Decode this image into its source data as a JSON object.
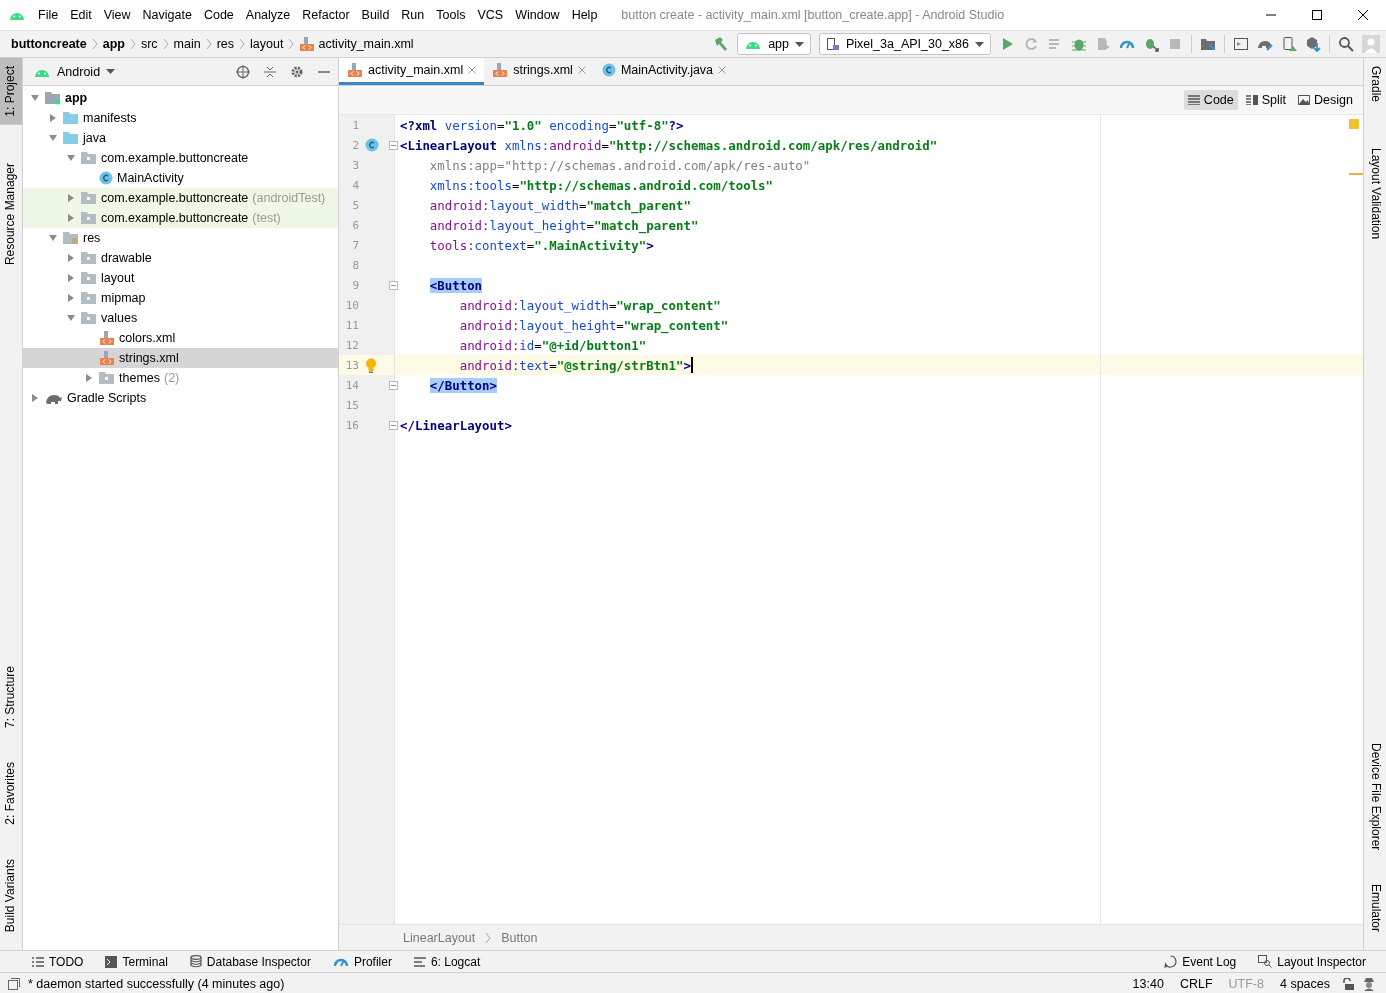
{
  "window": {
    "title": "button create - activity_main.xml [button_create.app] - Android Studio"
  },
  "menu": [
    "File",
    "Edit",
    "View",
    "Navigate",
    "Code",
    "Analyze",
    "Refactor",
    "Build",
    "Run",
    "Tools",
    "VCS",
    "Window",
    "Help"
  ],
  "breadcrumbs": [
    {
      "label": "buttoncreate",
      "bold": true
    },
    {
      "label": "app",
      "bold": true
    },
    {
      "label": "src",
      "bold": false
    },
    {
      "label": "main",
      "bold": false
    },
    {
      "label": "res",
      "bold": false
    },
    {
      "label": "layout",
      "bold": false
    },
    {
      "label": "activity_main.xml",
      "bold": false,
      "kind": "xml"
    }
  ],
  "toolbar": {
    "run_config": "app",
    "device": "Pixel_3a_API_30_x86",
    "icons": [
      {
        "kind": "run",
        "disabled": false
      },
      {
        "kind": "rerun",
        "disabled": true
      },
      {
        "kind": "apply",
        "disabled": true
      },
      {
        "kind": "debug",
        "disabled": false
      },
      {
        "kind": "profile",
        "disabled": true
      },
      {
        "kind": "gauge",
        "disabled": false
      },
      {
        "kind": "attach",
        "disabled": false
      },
      {
        "kind": "stop",
        "disabled": true
      },
      {
        "kind": "sep"
      },
      {
        "kind": "structure",
        "disabled": false
      },
      {
        "kind": "sep"
      },
      {
        "kind": "avd",
        "disabled": false
      },
      {
        "kind": "sync",
        "disabled": false
      },
      {
        "kind": "device",
        "disabled": false
      },
      {
        "kind": "sdk",
        "disabled": false
      },
      {
        "kind": "sep"
      },
      {
        "kind": "search",
        "disabled": false
      },
      {
        "kind": "avatar",
        "disabled": false
      }
    ]
  },
  "left_strip": {
    "top": [
      {
        "label": "1: Project",
        "selected": true
      },
      {
        "label": "Resource Manager",
        "selected": false
      }
    ],
    "bottom": [
      {
        "label": "7: Structure",
        "selected": false
      },
      {
        "label": "2: Favorites",
        "selected": false
      },
      {
        "label": "Build Variants",
        "selected": false
      }
    ]
  },
  "right_strip": {
    "top": [
      {
        "label": "Gradle",
        "selected": false
      },
      {
        "label": "Layout Validation",
        "selected": false
      }
    ],
    "bottom": [
      {
        "label": "Device File Explorer",
        "selected": false
      },
      {
        "label": "Emulator",
        "selected": false
      }
    ]
  },
  "project_panel": {
    "view": "Android",
    "tree": [
      {
        "label": "app",
        "kind": "module",
        "expanded": true,
        "selected": false,
        "children": [
          {
            "label": "manifests",
            "kind": "folder",
            "expanded": false,
            "selected": false
          },
          {
            "label": "java",
            "kind": "folder",
            "expanded": true,
            "selected": false,
            "children": [
              {
                "label": "com.example.buttoncreate",
                "kind": "package",
                "expanded": true,
                "selected": false,
                "children": [
                  {
                    "label": "MainActivity",
                    "kind": "class",
                    "selected": false
                  }
                ]
              },
              {
                "label": "com.example.buttoncreate",
                "suffix": "(androidTest)",
                "kind": "package",
                "expanded": false,
                "selected": false,
                "test": true
              },
              {
                "label": "com.example.buttoncreate",
                "suffix": "(test)",
                "kind": "package",
                "expanded": false,
                "selected": false,
                "test": true
              }
            ]
          },
          {
            "label": "res",
            "kind": "res",
            "expanded": true,
            "selected": false,
            "children": [
              {
                "label": "drawable",
                "kind": "package",
                "expanded": false,
                "selected": false
              },
              {
                "label": "layout",
                "kind": "package",
                "expanded": false,
                "selected": false
              },
              {
                "label": "mipmap",
                "kind": "package",
                "expanded": false,
                "selected": false
              },
              {
                "label": "values",
                "kind": "package",
                "expanded": true,
                "selected": false,
                "children": [
                  {
                    "label": "colors.xml",
                    "kind": "xml",
                    "selected": false
                  },
                  {
                    "label": "strings.xml",
                    "kind": "xml",
                    "selected": true
                  },
                  {
                    "label": "themes",
                    "suffix": "(2)",
                    "kind": "package",
                    "expanded": false,
                    "selected": false
                  }
                ]
              }
            ]
          }
        ]
      },
      {
        "label": "Gradle Scripts",
        "kind": "gradle",
        "expanded": false,
        "selected": false
      }
    ]
  },
  "editor": {
    "tabs": [
      {
        "label": "activity_main.xml",
        "kind": "xml",
        "selected": true
      },
      {
        "label": "strings.xml",
        "kind": "xml",
        "selected": false
      },
      {
        "label": "MainActivity.java",
        "kind": "class",
        "selected": false
      }
    ],
    "modes": [
      {
        "label": "Code",
        "selected": true
      },
      {
        "label": "Split",
        "selected": false
      },
      {
        "label": "Design",
        "selected": false
      }
    ],
    "lines": [
      {
        "number": "1",
        "current": false,
        "fold": false,
        "tokens": [
          {
            "kind": "tag",
            "t": "<?xml"
          },
          {
            "kind": "attr",
            "t": " version"
          },
          {
            "kind": "text",
            "t": "="
          },
          {
            "kind": "value",
            "t": "\"1.0\""
          },
          {
            "kind": "attr",
            "t": " encoding"
          },
          {
            "kind": "text",
            "t": "="
          },
          {
            "kind": "value",
            "t": "\"utf-8\""
          },
          {
            "kind": "tag",
            "t": "?>"
          }
        ]
      },
      {
        "number": "2",
        "current": false,
        "fold": true,
        "gutter": {
          "kind": "class"
        },
        "tokens": [
          {
            "kind": "tag",
            "t": "<LinearLayout"
          },
          {
            "kind": "attr",
            "t": " xmlns:"
          },
          {
            "kind": "ns",
            "t": "android"
          },
          {
            "kind": "text",
            "t": "="
          },
          {
            "kind": "value",
            "t": "\"http://schemas.android.com/apk/res/android\""
          }
        ]
      },
      {
        "number": "3",
        "current": false,
        "fold": false,
        "tokens": [
          {
            "kind": "muted",
            "t": "    xmlns:app=\"http://schemas.android.com/apk/res-auto\""
          }
        ]
      },
      {
        "number": "4",
        "current": false,
        "fold": false,
        "tokens": [
          {
            "kind": "attr",
            "t": "    xmlns:tools"
          },
          {
            "kind": "text",
            "t": "="
          },
          {
            "kind": "value",
            "t": "\"http://schemas.android.com/tools\""
          }
        ]
      },
      {
        "number": "5",
        "current": false,
        "fold": false,
        "tokens": [
          {
            "kind": "ns",
            "t": "    android:"
          },
          {
            "kind": "attr",
            "t": "layout_width"
          },
          {
            "kind": "text",
            "t": "="
          },
          {
            "kind": "value",
            "t": "\"match_parent\""
          }
        ]
      },
      {
        "number": "6",
        "current": false,
        "fold": false,
        "tokens": [
          {
            "kind": "ns",
            "t": "    android:"
          },
          {
            "kind": "attr",
            "t": "layout_height"
          },
          {
            "kind": "text",
            "t": "="
          },
          {
            "kind": "value",
            "t": "\"match_parent\""
          }
        ]
      },
      {
        "number": "7",
        "current": false,
        "fold": false,
        "tokens": [
          {
            "kind": "ns",
            "t": "    tools:"
          },
          {
            "kind": "attr",
            "t": "context"
          },
          {
            "kind": "text",
            "t": "="
          },
          {
            "kind": "value",
            "t": "\".MainActivity\""
          },
          {
            "kind": "tag",
            "t": ">"
          }
        ]
      },
      {
        "number": "8",
        "current": false,
        "fold": false
      },
      {
        "number": "9",
        "current": false,
        "fold": true,
        "tokens": [
          {
            "kind": "tag-hl",
            "t": "    <Button"
          }
        ]
      },
      {
        "number": "10",
        "current": false,
        "fold": false,
        "tokens": [
          {
            "kind": "ns",
            "t": "        android:"
          },
          {
            "kind": "attr",
            "t": "layout_width"
          },
          {
            "kind": "text",
            "t": "="
          },
          {
            "kind": "value",
            "t": "\"wrap_content\""
          }
        ]
      },
      {
        "number": "11",
        "current": false,
        "fold": false,
        "tokens": [
          {
            "kind": "ns",
            "t": "        android:"
          },
          {
            "kind": "attr",
            "t": "layout_height"
          },
          {
            "kind": "text",
            "t": "="
          },
          {
            "kind": "value",
            "t": "\"wrap_content\""
          }
        ]
      },
      {
        "number": "12",
        "current": false,
        "fold": false,
        "tokens": [
          {
            "kind": "ns",
            "t": "        android:"
          },
          {
            "kind": "attr",
            "t": "id"
          },
          {
            "kind": "text",
            "t": "="
          },
          {
            "kind": "value",
            "t": "\"@+id/button1\""
          }
        ]
      },
      {
        "number": "13",
        "current": true,
        "fold": false,
        "gutter": {
          "kind": "bulb"
        },
        "tokens": [
          {
            "kind": "ns",
            "t": "        android:"
          },
          {
            "kind": "attr",
            "t": "text"
          },
          {
            "kind": "text",
            "t": "="
          },
          {
            "kind": "value",
            "t": "\"@string/strBtn1\""
          },
          {
            "kind": "tag",
            "t": ">"
          }
        ]
      },
      {
        "number": "14",
        "current": false,
        "fold": true,
        "tokens": [
          {
            "kind": "tag-hl",
            "t": "    </Button>"
          }
        ]
      },
      {
        "number": "15",
        "current": false,
        "fold": false
      },
      {
        "number": "16",
        "current": false,
        "fold": true,
        "tokens": [
          {
            "kind": "tag",
            "t": "</LinearLayout>"
          }
        ]
      }
    ],
    "breadcrumbs": [
      "LinearLayout",
      "Button"
    ]
  },
  "bottom_tools": {
    "left": [
      {
        "label": "TODO",
        "kind": "list"
      },
      {
        "label": "Terminal",
        "kind": "terminal"
      },
      {
        "label": "Database Inspector",
        "kind": "database"
      },
      {
        "label": "Profiler",
        "kind": "gauge"
      },
      {
        "label": "6: Logcat",
        "kind": "lines"
      }
    ],
    "right": [
      {
        "label": "Event Log",
        "kind": "bubble"
      },
      {
        "label": "Layout Inspector",
        "kind": "inspect"
      }
    ]
  },
  "status": {
    "message": "* daemon started successfully (4 minutes ago)",
    "items": [
      {
        "label": "13:40",
        "muted": false
      },
      {
        "label": "CRLF",
        "muted": false
      },
      {
        "label": "UTF-8",
        "muted": true
      },
      {
        "label": "4 spaces",
        "muted": false
      }
    ]
  }
}
